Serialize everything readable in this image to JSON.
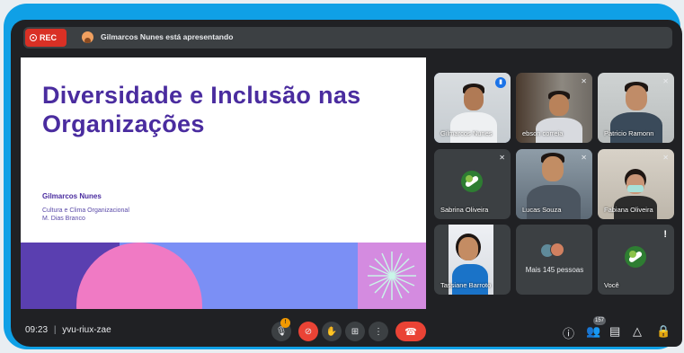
{
  "topbar": {
    "rec_label": "REC",
    "presenting_text": "Gilmarcos Nunes está apresentando"
  },
  "slide": {
    "title": "Diversidade e Inclusão nas Organizações",
    "author": "Gilmarcos Nunes",
    "subtitle_line1": "Cultura e Clima Organizacional",
    "subtitle_line2": "M. Dias Branco"
  },
  "participants": [
    {
      "name": "Gilmarcos Nunes",
      "state": "speaking"
    },
    {
      "name": "ebson correia",
      "state": "muted"
    },
    {
      "name": "Patricio Ramonn",
      "state": "muted"
    },
    {
      "name": "Sabrina Oliveira",
      "state": "muted"
    },
    {
      "name": "Lucas Souza",
      "state": "muted"
    },
    {
      "name": "Fabiana Oliveira",
      "state": "muted"
    },
    {
      "name": "Tassiane Barroto",
      "state": "normal"
    },
    {
      "name": "Mais 145 pessoas",
      "state": "overflow"
    },
    {
      "name": "Você",
      "state": "self"
    }
  ],
  "bottom": {
    "time": "09:23",
    "meeting_code": "yvu-riux-zae",
    "mic_badge": "!",
    "people_count": "157"
  },
  "colors": {
    "accent": "#0fa0e6",
    "slide_title": "#4a2c9f",
    "end_call": "#ea4335",
    "rec": "#d93025"
  },
  "icons": [
    "rec-icon",
    "mic-icon",
    "camera-off-icon",
    "raise-hand-icon",
    "present-icon",
    "more-icon",
    "end-call-icon",
    "info-icon",
    "people-icon",
    "chat-icon",
    "activities-icon",
    "lock-icon"
  ]
}
